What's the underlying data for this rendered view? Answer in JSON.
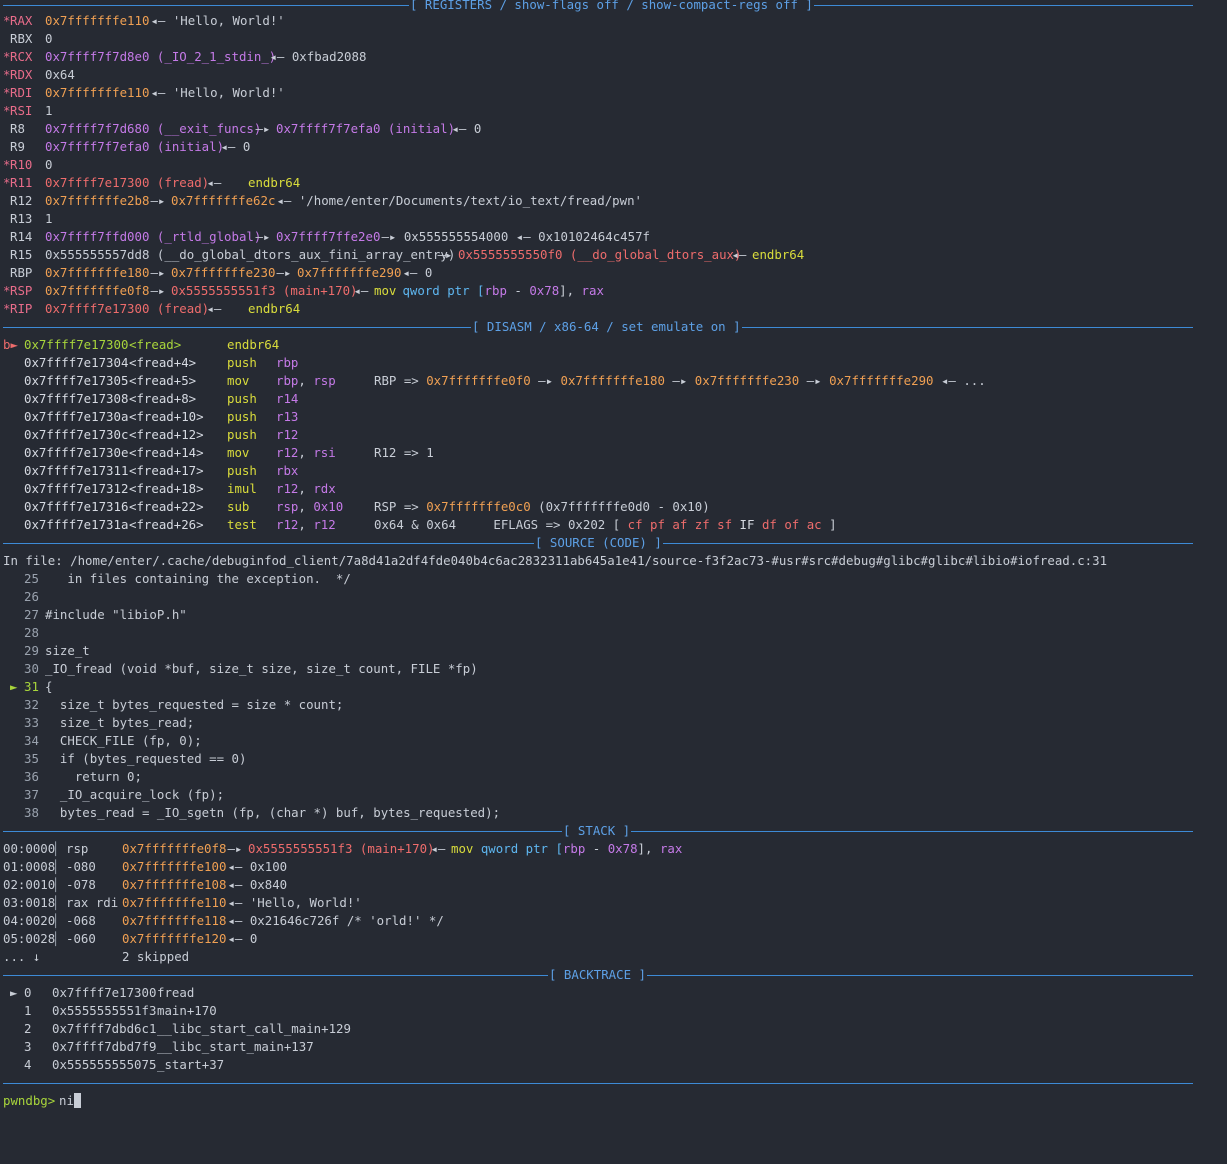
{
  "colors": {
    "background": "#262a33",
    "header": "#5da0e6",
    "stack_addr": "#f0a053",
    "heap_or_lib": "#c57ae8",
    "code": "#ee6c6c",
    "instruction": "#d9dc3c",
    "prompt": "#a8d53b"
  },
  "headers": {
    "registers": "[ REGISTERS / show-flags off / show-compact-regs off ]",
    "disasm": "[ DISASM / x86-64 / set emulate on ]",
    "source": "[ SOURCE (CODE) ]",
    "stack": "[ STACK ]",
    "backtrace": "[ BACKTRACE ]"
  },
  "registers": {
    "rax": {
      "mark": "*",
      "name": "RAX",
      "value": "0x7fffffffe110",
      "rest": " ◂— 'Hello, World!'"
    },
    "rbx": {
      "mark": " ",
      "name": "RBX",
      "value": "0",
      "rest": ""
    },
    "rcx": {
      "mark": "*",
      "name": "RCX",
      "value": "0x7ffff7f7d8e0 (_IO_2_1_stdin_)",
      "rest": " ◂— 0xfbad2088"
    },
    "rdx": {
      "mark": "*",
      "name": "RDX",
      "value": "0x64",
      "rest": ""
    },
    "rdi": {
      "mark": "*",
      "name": "RDI",
      "value": "0x7fffffffe110",
      "rest": " ◂— 'Hello, World!'"
    },
    "rsi": {
      "mark": "*",
      "name": "RSI",
      "value": "1",
      "rest": ""
    },
    "r8": {
      "mark": " ",
      "name": "R8",
      "value": "0x7ffff7f7d680 (__exit_funcs)",
      "arrow": " —▸ ",
      "v2": "0x7ffff7f7efa0 (initial)",
      "rest": " ◂— 0"
    },
    "r9": {
      "mark": " ",
      "name": "R9",
      "value": "0x7ffff7f7efa0 (initial)",
      "rest": " ◂— 0"
    },
    "r10": {
      "mark": "*",
      "name": "R10",
      "value": "0",
      "rest": ""
    },
    "r11": {
      "mark": "*",
      "name": "R11",
      "value": "0x7ffff7e17300 (fread)",
      "rest": " ◂— ",
      "code": "endbr64"
    },
    "r12": {
      "mark": " ",
      "name": "R12",
      "value": "0x7fffffffe2b8",
      "arrow": " —▸ ",
      "v2": "0x7fffffffe62c",
      "rest": " ◂— '/home/enter/Documents/text/io_text/fread/pwn'"
    },
    "r13": {
      "mark": " ",
      "name": "R13",
      "value": "1",
      "rest": ""
    },
    "r14": {
      "mark": " ",
      "name": "R14",
      "value": "0x7ffff7ffd000 (_rtld_global)",
      "arrow": " —▸ ",
      "v2": "0x7ffff7ffe2e0",
      "rest": " —▸ 0x555555554000 ◂— 0x10102464c457f"
    },
    "r15": {
      "mark": " ",
      "name": "R15",
      "value": "0x555555557dd8 (__do_global_dtors_aux_fini_array_entry)",
      "arrow": " —▸ ",
      "v2": "0x5555555550f0 (__do_global_dtors_aux)",
      "rest": " ◂— ",
      "code": "endbr64"
    },
    "rbp": {
      "mark": " ",
      "name": "RBP",
      "value": "0x7fffffffe180",
      "arrow": " —▸ ",
      "v2": "0x7fffffffe230",
      "arrow2": " —▸ ",
      "v3": "0x7fffffffe290",
      "rest": " ◂— 0"
    },
    "rsp": {
      "mark": "*",
      "name": "RSP",
      "value": "0x7fffffffe0f8",
      "arrow": " —▸ ",
      "v2": "0x5555555551f3 (main+170)",
      "rest": " ◂— ",
      "code": "mov",
      "code2": " qword ptr [",
      "code3": "rbp",
      "code4": " - ",
      "code5": "0x78",
      "code6": "], ",
      "code7": "rax"
    },
    "rip": {
      "mark": "*",
      "name": "RIP",
      "value": "0x7ffff7e17300 (fread)",
      "rest": " ◂— ",
      "code": "endbr64"
    }
  },
  "disasm": [
    {
      "mark": "b►",
      "addr": "0x7ffff7e17300",
      "sym": "<fread>",
      "op": "endbr64",
      "args": "",
      "note": ""
    },
    {
      "mark": "",
      "addr": "0x7ffff7e17304",
      "sym": "<fread+4>",
      "op": "push",
      "args": "rbp",
      "note": ""
    },
    {
      "mark": "",
      "addr": "0x7ffff7e17305",
      "sym": "<fread+5>",
      "op": "mov",
      "args": "rbp, rsp",
      "note": "RBP => "
    },
    {
      "mark": "",
      "addr": "0x7ffff7e17308",
      "sym": "<fread+8>",
      "op": "push",
      "args": "r14",
      "note": ""
    },
    {
      "mark": "",
      "addr": "0x7ffff7e1730a",
      "sym": "<fread+10>",
      "op": "push",
      "args": "r13",
      "note": ""
    },
    {
      "mark": "",
      "addr": "0x7ffff7e1730c",
      "sym": "<fread+12>",
      "op": "push",
      "args": "r12",
      "note": ""
    },
    {
      "mark": "",
      "addr": "0x7ffff7e1730e",
      "sym": "<fread+14>",
      "op": "mov",
      "args": "r12, rsi",
      "note": "R12 => 1"
    },
    {
      "mark": "",
      "addr": "0x7ffff7e17311",
      "sym": "<fread+17>",
      "op": "push",
      "args": "rbx",
      "note": ""
    },
    {
      "mark": "",
      "addr": "0x7ffff7e17312",
      "sym": "<fread+18>",
      "op": "imul",
      "args": "r12, rdx",
      "note": ""
    },
    {
      "mark": "",
      "addr": "0x7ffff7e17316",
      "sym": "<fread+22>",
      "op": "sub",
      "args": "rsp, 0x10",
      "note": "RSP => "
    },
    {
      "mark": "",
      "addr": "0x7ffff7e1731a",
      "sym": "<fread+26>",
      "op": "test",
      "args": "r12, r12",
      "note": "0x64 & 0x64     EFLAGS => 0x202 [ "
    }
  ],
  "disasm_extra": {
    "rbp_chain_1": "0x7fffffffe0f0",
    "rbp_chain_2": "0x7fffffffe180",
    "rbp_chain_3": "0x7fffffffe230",
    "rbp_chain_4": "0x7fffffffe290",
    "rbp_chain_tail": " ◂— ...",
    "rsp_new": "0x7fffffffe0c0",
    "rsp_expr": " (0x7fffffffe0d0 - 0x10)",
    "flags_off": "cf pf af zf sf",
    "flags_on": "IF",
    "flags_off2": "df of ac",
    "flags_close": " ]"
  },
  "source": {
    "file": "In file: /home/enter/.cache/debuginfod_client/7a8d41a2df4fde040b4c6ac2832311ab645a1e41/source-f3f2ac73-#usr#src#debug#glibc#glibc#libio#iofread.c:31",
    "lines": [
      {
        "n": "25",
        "text": "   in files containing the exception.  */"
      },
      {
        "n": "26",
        "text": ""
      },
      {
        "n": "27",
        "text": "#include \"libioP.h\""
      },
      {
        "n": "28",
        "text": ""
      },
      {
        "n": "29",
        "text": "size_t"
      },
      {
        "n": "30",
        "text": "_IO_fread (void *buf, size_t size, size_t count, FILE *fp)"
      },
      {
        "n": "31",
        "text": "{",
        "current": true,
        "marker": "►"
      },
      {
        "n": "32",
        "text": "  size_t bytes_requested = size * count;"
      },
      {
        "n": "33",
        "text": "  size_t bytes_read;"
      },
      {
        "n": "34",
        "text": "  CHECK_FILE (fp, 0);"
      },
      {
        "n": "35",
        "text": "  if (bytes_requested == 0)"
      },
      {
        "n": "36",
        "text": "    return 0;"
      },
      {
        "n": "37",
        "text": "  _IO_acquire_lock (fp);"
      },
      {
        "n": "38",
        "text": "  bytes_read = _IO_sgetn (fp, (char *) buf, bytes_requested);"
      }
    ]
  },
  "stack": [
    {
      "idx": "00:0000",
      "off": "rsp",
      "addr": "0x7fffffffe0f8",
      "rest": " —▸ ",
      "v2": "0x5555555551f3 (main+170)",
      "tail": " ◂— "
    },
    {
      "idx": "01:0008",
      "off": "-080",
      "addr": "0x7fffffffe100",
      "rest": " ◂— 0x100"
    },
    {
      "idx": "02:0010",
      "off": "-078",
      "addr": "0x7fffffffe108",
      "rest": " ◂— 0x840"
    },
    {
      "idx": "03:0018",
      "off": "rax rdi",
      "addr": "0x7fffffffe110",
      "rest": " ◂— 'Hello, World!'"
    },
    {
      "idx": "04:0020",
      "off": "-068",
      "addr": "0x7fffffffe118",
      "rest": " ◂— 0x21646c726f /* 'orld!' */"
    },
    {
      "idx": "05:0028",
      "off": "-060",
      "addr": "0x7fffffffe120",
      "rest": " ◂— 0"
    }
  ],
  "stack_skip": {
    "dots": "... ↓",
    "text": "2 skipped"
  },
  "backtrace": [
    {
      "mark": "►",
      "n": "0",
      "addr": "0x7ffff7e17300",
      "fn": "fread"
    },
    {
      "mark": "",
      "n": "1",
      "addr": "0x5555555551f3",
      "fn": "main+170"
    },
    {
      "mark": "",
      "n": "2",
      "addr": "0x7ffff7dbd6c1",
      "fn": "__libc_start_call_main+129"
    },
    {
      "mark": "",
      "n": "3",
      "addr": "0x7ffff7dbd7f9",
      "fn": "__libc_start_main+137"
    },
    {
      "mark": "",
      "n": "4",
      "addr": "0x555555555075",
      "fn": "_start+37"
    }
  ],
  "prompt": {
    "label": "pwndbg>",
    "input": "ni"
  }
}
